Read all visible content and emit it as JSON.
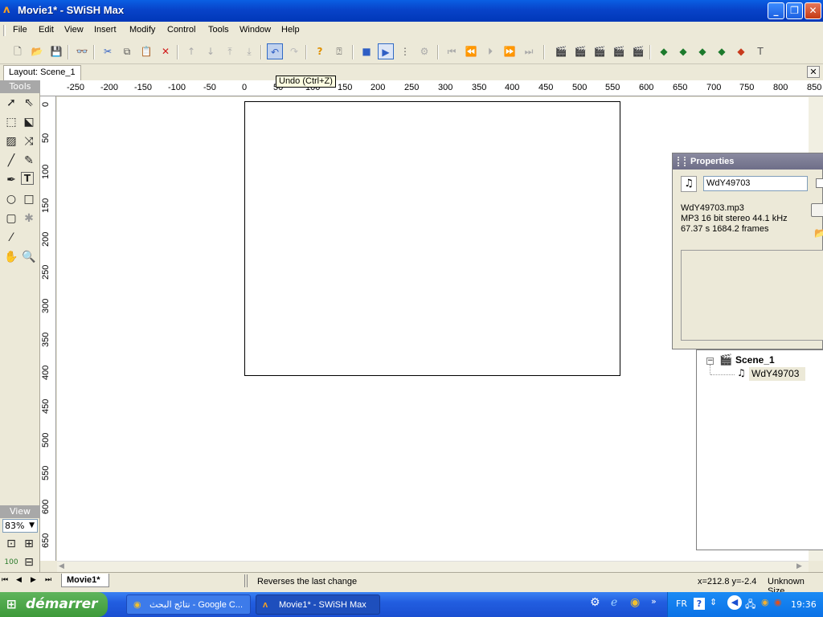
{
  "window": {
    "title": "Movie1* - SWiSH Max",
    "min": "_",
    "max": "❐",
    "close": "✕"
  },
  "menu": [
    "File",
    "Edit",
    "View",
    "Insert",
    "Modify",
    "Control",
    "Tools",
    "Window",
    "Help"
  ],
  "layout": {
    "tab": "Layout: Scene_1",
    "close": "✕"
  },
  "tooltip": "Undo (Ctrl+Z)",
  "tools_panel": {
    "header": "Tools",
    "view_header": "View",
    "zoom": "83%"
  },
  "ruler": {
    "top": [
      "-250",
      "-200",
      "-150",
      "-100",
      "-50",
      "0",
      "50",
      "100",
      "150",
      "200",
      "250",
      "300",
      "350",
      "400",
      "450",
      "500",
      "550",
      "600",
      "650",
      "700",
      "750",
      "800",
      "850"
    ],
    "left": [
      "0",
      "50",
      "100",
      "150",
      "200",
      "250",
      "300",
      "350",
      "400",
      "450",
      "500",
      "550",
      "600",
      "650"
    ]
  },
  "properties": {
    "title": "Properties",
    "name": "WdY49703",
    "file": "WdY49703.mp3",
    "format": "MP3 16 bit stereo 44.1 kHz",
    "duration": "67.37 s 1684.2 frames"
  },
  "outline": {
    "scene": "Scene_1",
    "item": "WdY49703"
  },
  "bottom_tab": "Movie1*",
  "status": {
    "hint": "Reverses the last change",
    "coords": "x=212.8 y=-2.4",
    "size": "Unknown Size"
  },
  "taskbar": {
    "start": "démarrer",
    "tasks": [
      "نتائج البحث - Google C...",
      "Movie1* - SWiSH Max"
    ],
    "lang": "FR",
    "clock": "19:36"
  }
}
